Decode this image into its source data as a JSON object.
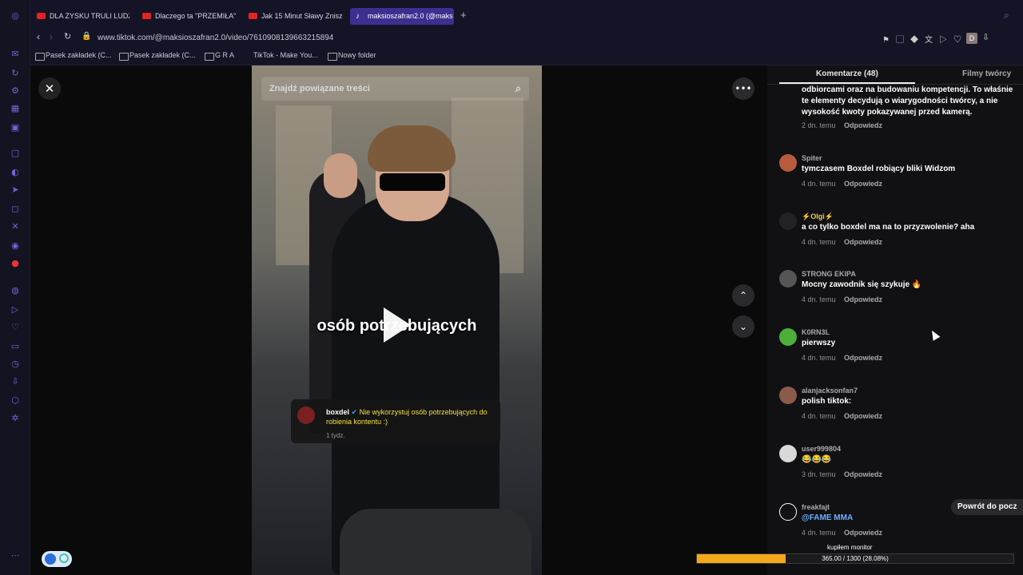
{
  "tabs": [
    {
      "label": "DLA ZYSKU TRULI LUDZI",
      "type": "youtube"
    },
    {
      "label": "Dlaczego ta \"PRZEMIŁA\"",
      "type": "youtube"
    },
    {
      "label": "Jak 15 Minut Sławy Zniszc",
      "type": "youtube"
    },
    {
      "label": "maksioszafran2.0 (@maks",
      "type": "tiktok",
      "active": true
    }
  ],
  "browser": {
    "url": "www.tiktok.com/@maksioszafran2.0/video/7610908139663215894",
    "profile_initial": "D"
  },
  "bookmarks": [
    "Pasek zakładek (C...",
    "Pasek zakładek (C...",
    "G R A",
    "TikTok - Make You...",
    "Nowy folder"
  ],
  "video": {
    "search_placeholder": "Znajdź powiązane treści",
    "caption": "osób potrzebujących",
    "reply": {
      "user": "boxdel",
      "text": "Nie wykorzystuj osób potrzebujących do robienia kontentu :)",
      "time": "1 tydz."
    }
  },
  "panel": {
    "tab_comments": "Komentarze (48)",
    "tab_creator": "Filmy twórcy",
    "partial_comment": {
      "text": "odbiorcami oraz na budowaniu kompetencji. To właśnie te elementy decydują o wiarygodności twórcy, a nie wysokość kwoty pokazywanej przed kamerą.",
      "meta": "2 dn. temu",
      "reply": "Odpowiedz"
    },
    "comments": [
      {
        "user": "Spiter",
        "text": "tymczasem Boxdel robiący bliki Widzom",
        "meta": "4 dn. temu",
        "reply": "Odpowiedz",
        "color": "#b85a3c"
      },
      {
        "user": "⚡Olgi⚡",
        "text": "a co tylko boxdel ma na to przyzwolenie? aha",
        "meta": "4 dn. temu",
        "reply": "Odpowiedz",
        "color": "#222"
      },
      {
        "user": "STRONG EKIPA",
        "text": "Mocny zawodnik się szykuje 🔥",
        "meta": "4 dn. temu",
        "reply": "Odpowiedz",
        "color": "#555"
      },
      {
        "user": "K0RN3L",
        "text": "pierwszy",
        "meta": "4 dn. temu",
        "reply": "Odpowiedz",
        "color": "#4caf3a"
      },
      {
        "user": "alanjacksonfan7",
        "text": "polish tiktok:",
        "meta": "4 dn. temu",
        "reply": "Odpowiedz",
        "color": "#8a5a4a"
      },
      {
        "user": "user999804",
        "text": "😂😂😂",
        "meta": "3 dn. temu",
        "reply": "Odpowiedz",
        "color": "#d9d9d9"
      },
      {
        "user": "freakfajt",
        "text": "@FAME MMA",
        "meta": "4 dn. temu",
        "reply": "Odpowiedz",
        "color": "#111"
      }
    ],
    "back_to_top": "Powrót do pocz"
  },
  "overlay": {
    "label": "kupiłem monitor",
    "progress_text": "365.00 / 1300 (28.08%)",
    "progress_fraction": 0.2808
  }
}
